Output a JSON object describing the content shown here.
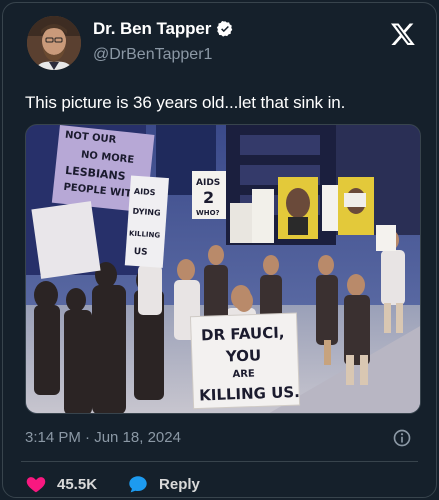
{
  "author": {
    "display_name": "Dr. Ben Tapper",
    "handle": "@DrBenTapper1",
    "verified": true
  },
  "tweet": {
    "text": "This picture is 36 years old...let that sink in.",
    "timestamp": "3:14 PM · Jun 18, 2024"
  },
  "media": {
    "signs": {
      "top_left": [
        "NOT OUR",
        "NO MORE",
        "LESBIANS",
        "PEOPLE WITH"
      ],
      "middle_left": [
        "AIDS",
        "DYING",
        "KILLING",
        "US"
      ],
      "aids_2": [
        "AIDS",
        "2",
        "WHO?"
      ],
      "front": [
        "DR FAUCI,",
        "YOU",
        "ARE",
        "KILLING US."
      ]
    }
  },
  "actions": {
    "likes": "45.5K",
    "reply": "Reply"
  },
  "colors": {
    "background": "#15202b",
    "border": "#38444d",
    "secondary_text": "#8b98a5",
    "like": "#f91880",
    "reply": "#1d9bf0",
    "verified": "#1d9bf0"
  }
}
